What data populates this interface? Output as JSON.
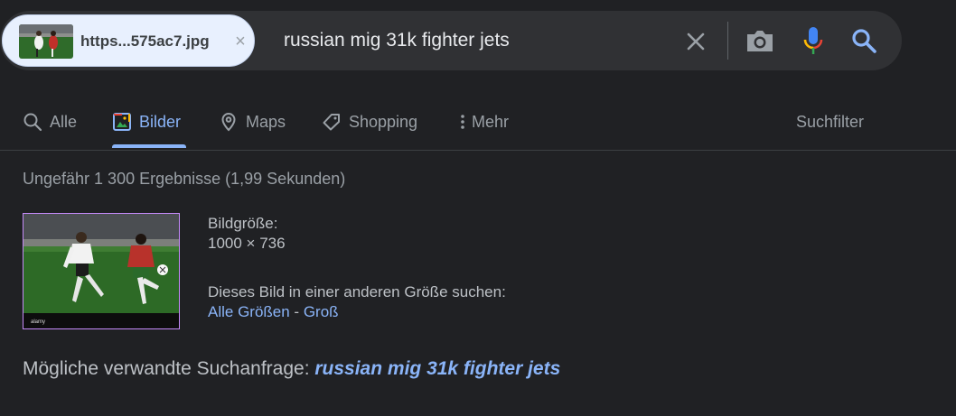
{
  "search": {
    "image_chip_label": "https...575ac7.jpg",
    "query": "russian mig 31k fighter jets"
  },
  "tabs": [
    {
      "label": "Alle",
      "icon": "search-icon"
    },
    {
      "label": "Bilder",
      "icon": "image-icon",
      "active": true
    },
    {
      "label": "Maps",
      "icon": "map-pin-icon"
    },
    {
      "label": "Shopping",
      "icon": "tag-icon"
    },
    {
      "label": "Mehr",
      "icon": "more-vert-icon"
    }
  ],
  "tools_label": "Suchfilter",
  "result_stats": "Ungefähr 1 300 Ergebnisse (1,99 Sekunden)",
  "image_info": {
    "size_label": "Bildgröße:",
    "size_value": "1000 × 736",
    "other_sizes_label": "Dieses Bild in einer anderen Größe suchen:",
    "all_sizes_link": "Alle Größen",
    "separator": " - ",
    "large_link": "Groß"
  },
  "related": {
    "label": "Mögliche verwandte Suchanfrage: ",
    "query": "russian mig 31k fighter jets"
  },
  "colors": {
    "background": "#202124",
    "accent": "#8ab4f8",
    "searchbar": "#303134"
  }
}
